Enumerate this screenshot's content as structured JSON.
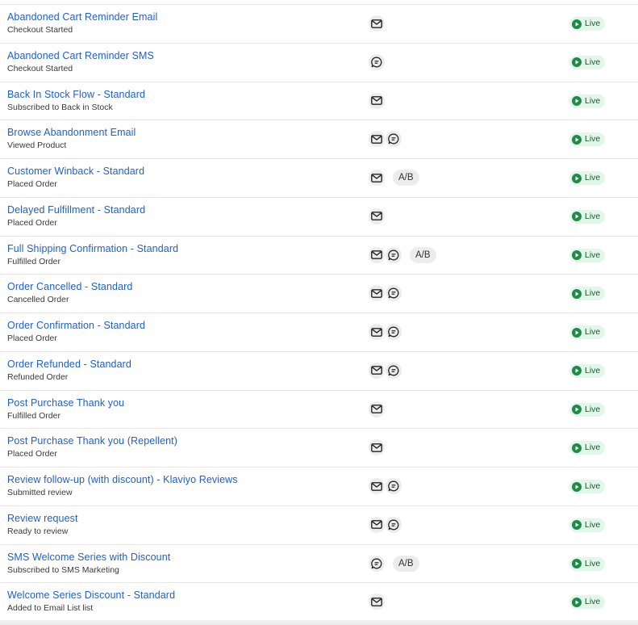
{
  "colors": {
    "link": "#1f5fcf",
    "live_bg": "#e2f6e9",
    "live_icon": "#1e8b4a",
    "chip_bg": "#ececec"
  },
  "icons": {
    "email": "email-icon",
    "sms": "sms-icon",
    "status": "play-circle-icon"
  },
  "flows": [
    {
      "name": "Abandoned Cart Reminder Email",
      "trigger": "Checkout Started",
      "channels": [
        "email"
      ],
      "ab": "",
      "status": "Live"
    },
    {
      "name": "Abandoned Cart Reminder SMS",
      "trigger": "Checkout Started",
      "channels": [
        "sms"
      ],
      "ab": "",
      "status": "Live"
    },
    {
      "name": "Back In Stock Flow - Standard",
      "trigger": "Subscribed to Back in Stock",
      "channels": [
        "email"
      ],
      "ab": "",
      "status": "Live"
    },
    {
      "name": "Browse Abandonment Email",
      "trigger": "Viewed Product",
      "channels": [
        "email",
        "sms"
      ],
      "ab": "",
      "status": "Live"
    },
    {
      "name": "Customer Winback - Standard",
      "trigger": "Placed Order",
      "channels": [
        "email"
      ],
      "ab": "A/B",
      "status": "Live"
    },
    {
      "name": "Delayed Fulfillment - Standard",
      "trigger": "Placed Order",
      "channels": [
        "email"
      ],
      "ab": "",
      "status": "Live"
    },
    {
      "name": "Full Shipping Confirmation - Standard",
      "trigger": "Fulfilled Order",
      "channels": [
        "email",
        "sms"
      ],
      "ab": "A/B",
      "status": "Live"
    },
    {
      "name": "Order Cancelled - Standard",
      "trigger": "Cancelled Order",
      "channels": [
        "email",
        "sms"
      ],
      "ab": "",
      "status": "Live"
    },
    {
      "name": "Order Confirmation - Standard",
      "trigger": "Placed Order",
      "channels": [
        "email",
        "sms"
      ],
      "ab": "",
      "status": "Live"
    },
    {
      "name": "Order Refunded - Standard",
      "trigger": "Refunded Order",
      "channels": [
        "email",
        "sms"
      ],
      "ab": "",
      "status": "Live"
    },
    {
      "name": "Post Purchase Thank you",
      "trigger": "Fulfilled Order",
      "channels": [
        "email"
      ],
      "ab": "",
      "status": "Live"
    },
    {
      "name": "Post Purchase Thank you (Repellent)",
      "trigger": "Placed Order",
      "channels": [
        "email"
      ],
      "ab": "",
      "status": "Live"
    },
    {
      "name": "Review follow-up (with discount) - Klaviyo Reviews",
      "trigger": "Submitted review",
      "channels": [
        "email",
        "sms"
      ],
      "ab": "",
      "status": "Live"
    },
    {
      "name": "Review request",
      "trigger": "Ready to review",
      "channels": [
        "email",
        "sms"
      ],
      "ab": "",
      "status": "Live"
    },
    {
      "name": "SMS Welcome Series with Discount",
      "trigger": "Subscribed to SMS Marketing",
      "channels": [
        "sms"
      ],
      "ab": "A/B",
      "status": "Live"
    },
    {
      "name": "Welcome Series Discount - Standard",
      "trigger": "Added to Email List list",
      "channels": [
        "email"
      ],
      "ab": "",
      "status": "Live"
    }
  ]
}
